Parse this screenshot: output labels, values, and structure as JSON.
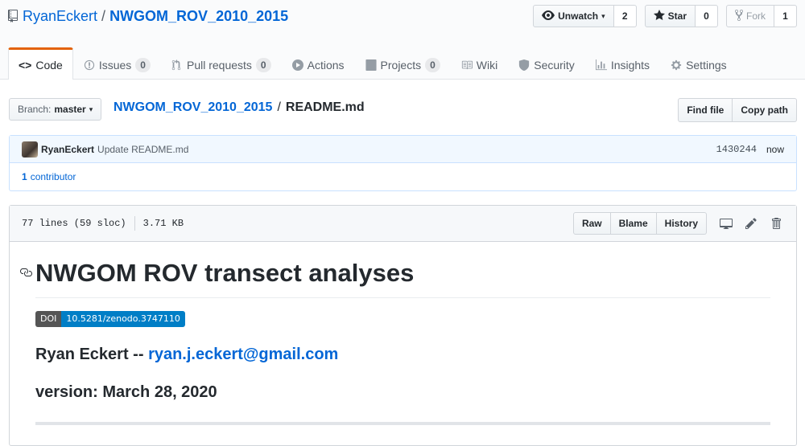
{
  "repo": {
    "owner": "RyanEckert",
    "separator": "/",
    "name": "NWGOM_ROV_2010_2015"
  },
  "actions": {
    "watch_label": "Unwatch",
    "watch_count": "2",
    "star_label": "Star",
    "star_count": "0",
    "fork_label": "Fork",
    "fork_count": "1"
  },
  "tabs": [
    {
      "label": "Code",
      "icon": "code-icon"
    },
    {
      "label": "Issues",
      "count": "0",
      "icon": "issue-icon"
    },
    {
      "label": "Pull requests",
      "count": "0",
      "icon": "pull-request-icon"
    },
    {
      "label": "Actions",
      "icon": "play-icon"
    },
    {
      "label": "Projects",
      "count": "0",
      "icon": "project-icon"
    },
    {
      "label": "Wiki",
      "icon": "book-icon"
    },
    {
      "label": "Security",
      "icon": "shield-icon"
    },
    {
      "label": "Insights",
      "icon": "graph-icon"
    },
    {
      "label": "Settings",
      "icon": "gear-icon"
    }
  ],
  "file_nav": {
    "branch_label": "Branch:",
    "branch_value": "master",
    "breadcrumb_repo": "NWGOM_ROV_2010_2015",
    "breadcrumb_sep": "/",
    "breadcrumb_file": "README.md",
    "find_file": "Find file",
    "copy_path": "Copy path"
  },
  "commit": {
    "author": "RyanEckert",
    "message": "Update README.md",
    "sha": "1430244",
    "time": "now",
    "contributors_count": "1",
    "contributors_label": "contributor"
  },
  "file": {
    "lines": "77 lines (59 sloc)",
    "size": "3.71 KB",
    "raw": "Raw",
    "blame": "Blame",
    "history": "History"
  },
  "readme": {
    "title": "NWGOM ROV transect analyses",
    "badge_left": "DOI",
    "badge_right": "10.5281/zenodo.3747110",
    "author_prefix": "Ryan Eckert --",
    "email": "ryan.j.eckert@gmail.com",
    "version": "version: March 28, 2020"
  },
  "colors": {
    "link": "#0366d6",
    "selected_tab_accent": "#e36209",
    "badge_blue": "#007ec6"
  }
}
